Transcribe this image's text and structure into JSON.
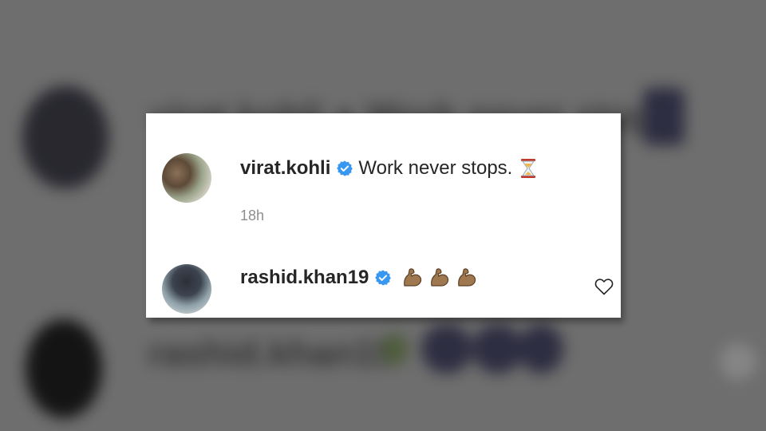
{
  "comments": [
    {
      "username": "virat.kohli",
      "verified": true,
      "text": "Work never stops.",
      "emoji": "hourglass-icon",
      "timestamp": "18h"
    },
    {
      "username": "rashid.khan19",
      "verified": true,
      "text": "",
      "emoji": "flexed-biceps-icon x3"
    }
  ],
  "colors": {
    "verified_blue": "#3897f0",
    "text": "#262626",
    "muted": "#8e8e8e",
    "background_blur": "#6e6e6e",
    "card": "#ffffff"
  }
}
